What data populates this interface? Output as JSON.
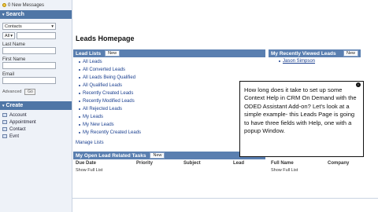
{
  "sidebar": {
    "messages": "0 New Messages",
    "search": {
      "header": "Search",
      "record_type": "Contacts",
      "scope": "All",
      "last_name_label": "Last Name",
      "first_name_label": "First Name",
      "email_label": "Email",
      "advanced_label": "Advanced",
      "go_label": "Go"
    },
    "create": {
      "header": "Create",
      "items": [
        "Account",
        "Appointment",
        "Contact",
        "Evnt"
      ]
    }
  },
  "main": {
    "title": "Leads Homepage",
    "lead_lists": {
      "header": "Lead Lists",
      "new_label": "New",
      "items": [
        "All Leads",
        "All Converted Leads",
        "All Leads Being Qualified",
        "All Qualified Leads",
        "Recently Created Leads",
        "Recently Modified Leads",
        "All Rejected Leads",
        "My Leads",
        "My New Leads",
        "My Recently Created Leads"
      ],
      "manage_label": "Manage Lists"
    },
    "recent": {
      "header": "My Recently Viewed Leads",
      "new_label": "New",
      "items": [
        "Jason Simpson"
      ]
    },
    "tasks": {
      "header": "My Open Lead Related Tasks",
      "new_label": "New",
      "columns": [
        "Due Date",
        "Priority",
        "Subject"
      ],
      "show_full_list": "Show Full List"
    },
    "right_section": {
      "columns": [
        "Lead",
        "Full Name",
        "Company"
      ],
      "show_full_list": "Show Full List"
    }
  },
  "popup": {
    "text": "How long does it take to set up some Context Help in CRM On Demand with the ODED Assistant Add-on? Let's look at a simple example- this Leads Page is going to have three fields with Help, one with a popup Window."
  }
}
